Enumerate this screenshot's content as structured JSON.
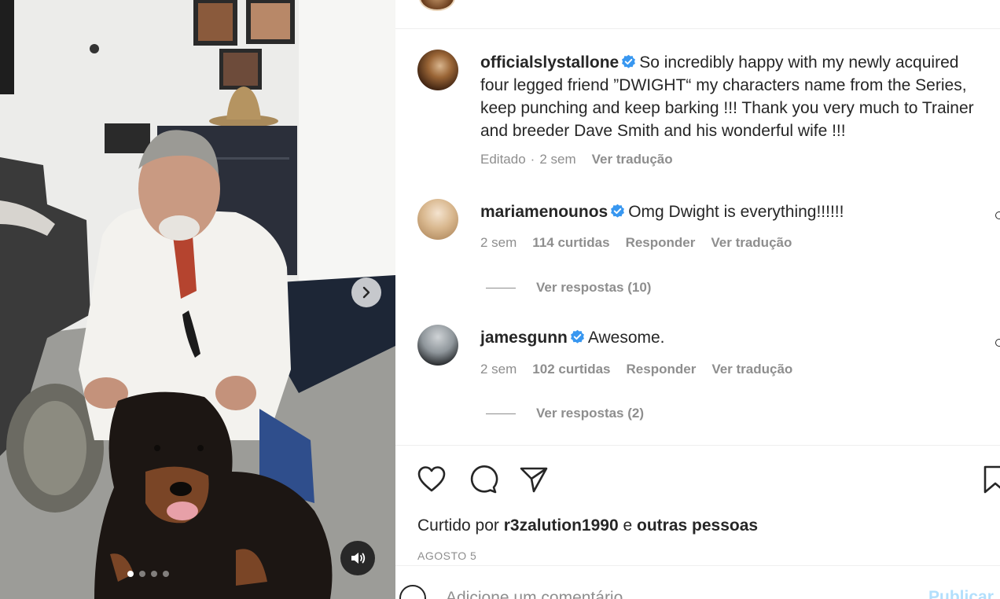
{
  "media": {
    "next_icon": "chevron-right-icon",
    "mute_icon": "speaker-icon",
    "carousel": {
      "count": 4,
      "active_index": 0
    }
  },
  "post": {
    "author": "officialslystallone",
    "caption": "So incredibly happy with my newly acquired four legged friend ”DWIGHT“ my characters name from the Series, keep punching and keep barking !!! Thank you very much to Trainer and breeder Dave Smith and his wonderful wife !!!",
    "edited": "Editado",
    "separator": "·",
    "time": "2 sem",
    "translate": "Ver tradução"
  },
  "comments": [
    {
      "user": "mariamenounos",
      "text": "Omg Dwight is everything!!!!!!",
      "time": "2 sem",
      "likes": "114 curtidas",
      "reply": "Responder",
      "translate": "Ver tradução",
      "view_replies": "Ver respostas (10)"
    },
    {
      "user": "jamesgunn",
      "text": "Awesome.",
      "time": "2 sem",
      "likes": "102 curtidas",
      "reply": "Responder",
      "translate": "Ver tradução",
      "view_replies": "Ver respostas (2)"
    }
  ],
  "actions": {
    "like_icon": "heart-icon",
    "comment_icon": "comment-icon",
    "share_icon": "paper-plane-icon",
    "save_icon": "bookmark-icon"
  },
  "likes": {
    "prefix": "Curtido por",
    "user": "r3zalution1990",
    "conjunction": "e",
    "others": "outras pessoas"
  },
  "date": "AGOSTO 5",
  "add_comment": {
    "placeholder": "Adicione um comentário...",
    "publish": "Publicar"
  },
  "colors": {
    "verified": "#3897f0",
    "muted_text": "#8e8e8e",
    "publish": "#b2dffc"
  }
}
